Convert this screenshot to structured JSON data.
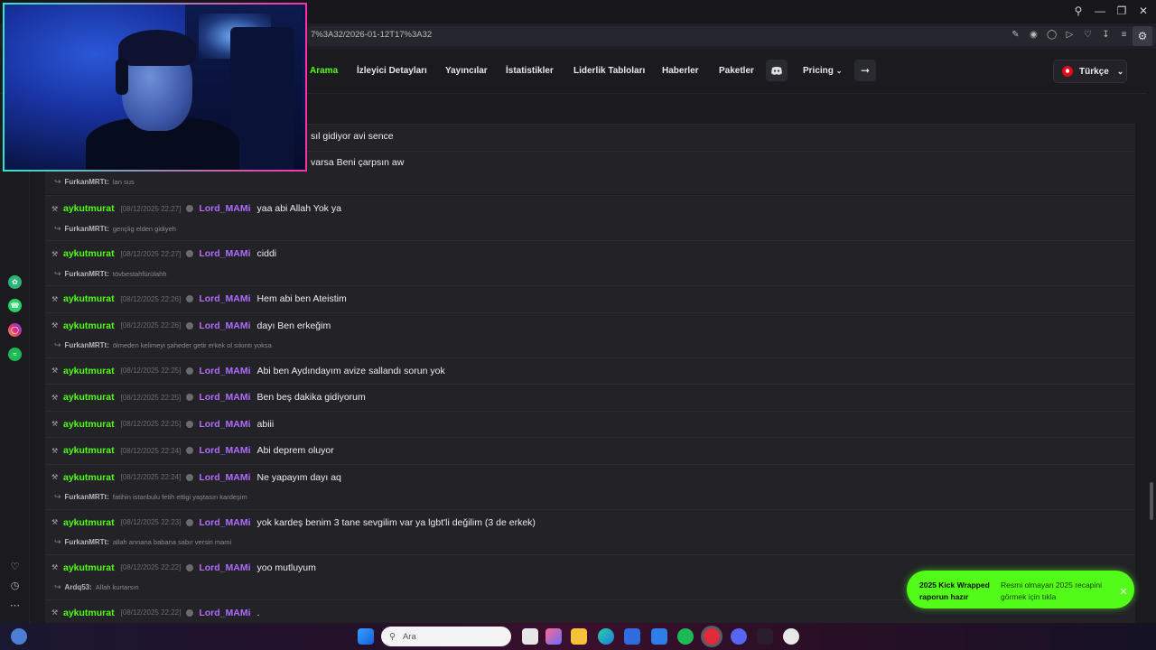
{
  "browser": {
    "url_fragment": "7%3A32/2026-01-12T17%3A32",
    "window_controls": [
      "search-icon",
      "minimize-icon",
      "restore-icon",
      "close-icon"
    ]
  },
  "nav": {
    "items": [
      {
        "label": "Arama",
        "active": true
      },
      {
        "label": "İzleyici Detayları",
        "active": false
      },
      {
        "label": "Yayıncılar",
        "active": false
      },
      {
        "label": "İstatistikler",
        "active": false
      },
      {
        "label": "Liderlik Tabloları",
        "active": false
      },
      {
        "label": "Haberler",
        "active": false
      },
      {
        "label": "Paketler",
        "active": false
      },
      {
        "label": "Pricing",
        "active": false
      }
    ],
    "language": "Türkçe"
  },
  "partial_lines": [
    "sıl gidiyor avi sence",
    "varsa Beni çarpsın aw"
  ],
  "chat": {
    "partial_reply": {
      "user": "FurkanMRTt:",
      "text": "lan sus"
    },
    "messages": [
      {
        "user": "aykutmurat",
        "time": "[08/12/2025 22:27]",
        "target": "Lord_MAMi",
        "text": "yaa abi Allah Yok ya",
        "reply_user": "FurkanMRTt:",
        "reply_text": "gençlig elden gidiyeh"
      },
      {
        "user": "aykutmurat",
        "time": "[08/12/2025 22:27]",
        "target": "Lord_MAMi",
        "text": "ciddi",
        "reply_user": "FurkanMRTt:",
        "reply_text": "tövbestahfürülahh"
      },
      {
        "user": "aykutmurat",
        "time": "[08/12/2025 22:26]",
        "target": "Lord_MAMi",
        "text": "Hem abi ben Ateistim",
        "reply_user": "",
        "reply_text": ""
      },
      {
        "user": "aykutmurat",
        "time": "[08/12/2025 22:26]",
        "target": "Lord_MAMi",
        "text": "dayı Ben erkeğim",
        "reply_user": "FurkanMRTt:",
        "reply_text": "ölmeden kelimeyi şaheder getir erkek ol sıkıntı yoksa"
      },
      {
        "user": "aykutmurat",
        "time": "[08/12/2025 22:25]",
        "target": "Lord_MAMi",
        "text": "Abi ben Aydındayım avize sallandı sorun yok",
        "reply_user": "",
        "reply_text": ""
      },
      {
        "user": "aykutmurat",
        "time": "[08/12/2025 22:25]",
        "target": "Lord_MAMi",
        "text": "Ben beş dakika gidiyorum",
        "reply_user": "",
        "reply_text": ""
      },
      {
        "user": "aykutmurat",
        "time": "[08/12/2025 22:25]",
        "target": "Lord_MAMi",
        "text": "abiii",
        "reply_user": "",
        "reply_text": ""
      },
      {
        "user": "aykutmurat",
        "time": "[08/12/2025 22:24]",
        "target": "Lord_MAMi",
        "text": "Abi deprem oluyor",
        "reply_user": "",
        "reply_text": ""
      },
      {
        "user": "aykutmurat",
        "time": "[08/12/2025 22:24]",
        "target": "Lord_MAMi",
        "text": "Ne yapayım dayı aq",
        "reply_user": "FurkanMRTt:",
        "reply_text": "fatihin istanbulu fetih ettigi yaştasın kardeşim"
      },
      {
        "user": "aykutmurat",
        "time": "[08/12/2025 22:23]",
        "target": "Lord_MAMi",
        "text": "yok kardeş benim 3 tane sevgilim var ya lgbt'li değilim (3 de erkek)",
        "reply_user": "FurkanMRTt:",
        "reply_text": "allah annana babana sabır versin mami"
      },
      {
        "user": "aykutmurat",
        "time": "[08/12/2025 22:22]",
        "target": "Lord_MAMi",
        "text": "yoo mutluyum",
        "reply_user": "Ardq53:",
        "reply_text": "Allah kurtarsın"
      },
      {
        "user": "aykutmurat",
        "time": "[08/12/2025 22:22]",
        "target": "Lord_MAMi",
        "text": ".",
        "reply_user": "",
        "reply_text": ""
      }
    ]
  },
  "toast": {
    "title": "2025 Kick Wrapped raporun hazır",
    "body": "Resmi olmayan 2025 recapini görmek için tıkla"
  },
  "taskbar": {
    "search_placeholder": "Ara"
  },
  "colors": {
    "accent": "#53fc18",
    "target_user": "#b26cff",
    "background": "#1b1b1f"
  }
}
